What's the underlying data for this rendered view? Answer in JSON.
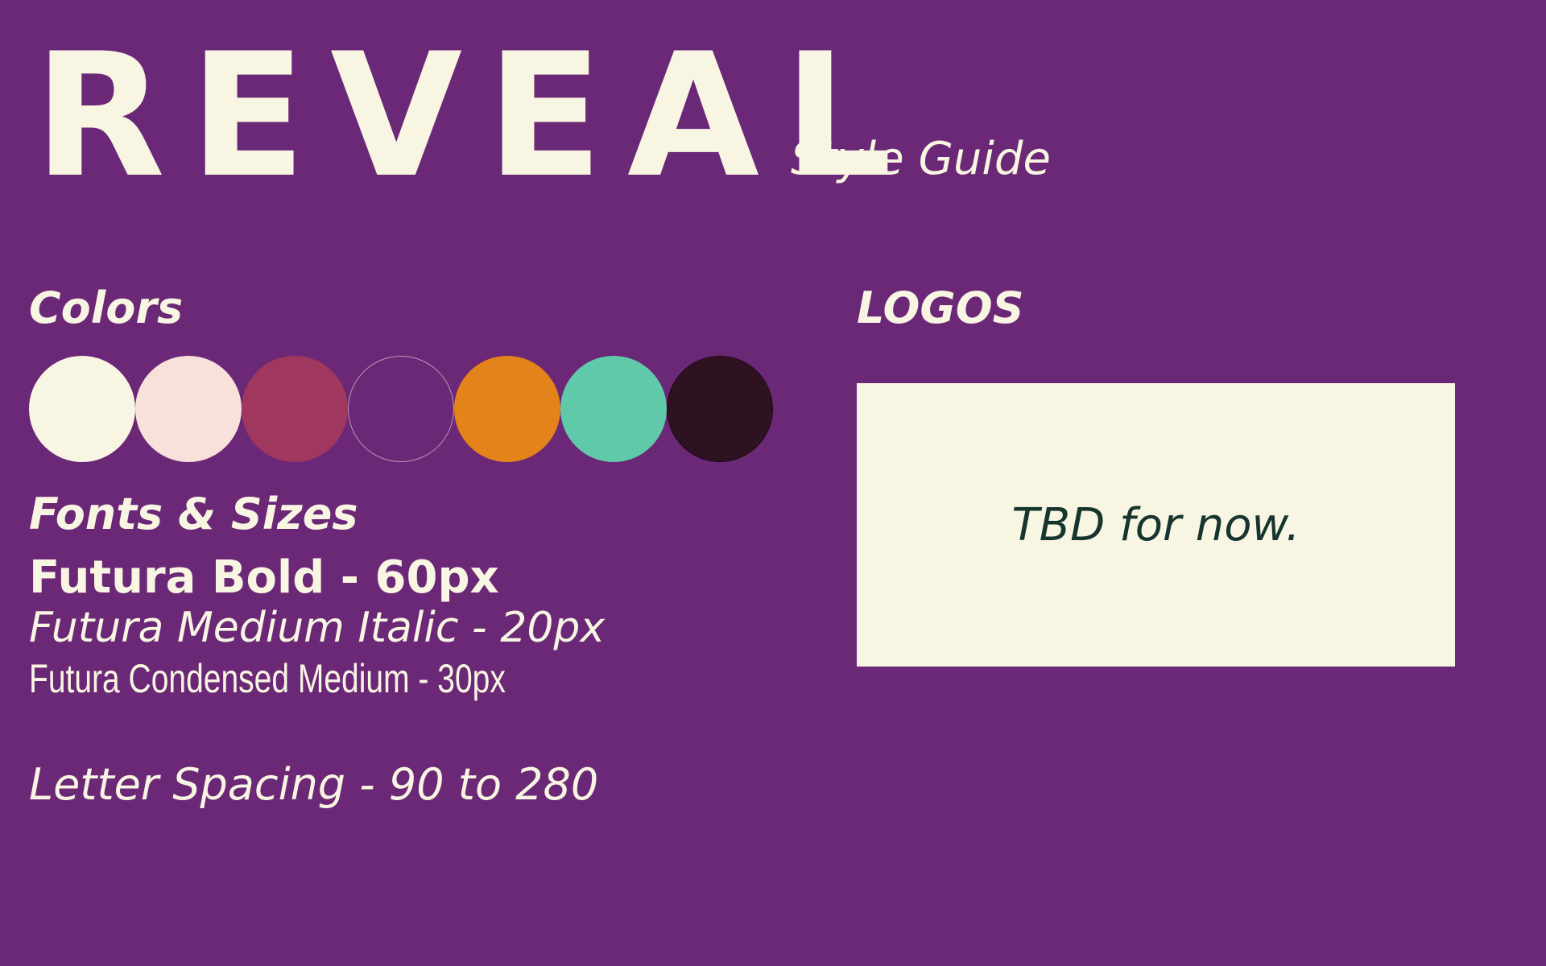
{
  "header": {
    "title": "REVEAL",
    "subtitle": "Style Guide"
  },
  "colors": {
    "heading": "Colors",
    "swatches": [
      {
        "name": "cream",
        "hex": "#f8f5e3"
      },
      {
        "name": "blush",
        "hex": "#f8e0db"
      },
      {
        "name": "raspberry",
        "hex": "#a0375f"
      },
      {
        "name": "purple",
        "hex": "#6b2877"
      },
      {
        "name": "orange",
        "hex": "#e4831a"
      },
      {
        "name": "mint",
        "hex": "#60c9a9"
      },
      {
        "name": "dark-plum",
        "hex": "#2e1221"
      }
    ]
  },
  "fonts": {
    "heading": "Fonts & Sizes",
    "samples": {
      "bold": "Futura Bold - 60px",
      "medium_italic": "Futura Medium Italic - 20px",
      "condensed": "Futura Condensed Medium - 30px"
    },
    "letter_spacing": "Letter Spacing - 90 to 280"
  },
  "logos": {
    "heading": "LOGOS",
    "placeholder": "TBD for now."
  },
  "theme": {
    "background": "#6b2877",
    "text": "#f8f5e3",
    "logo_text": "#17352f"
  }
}
